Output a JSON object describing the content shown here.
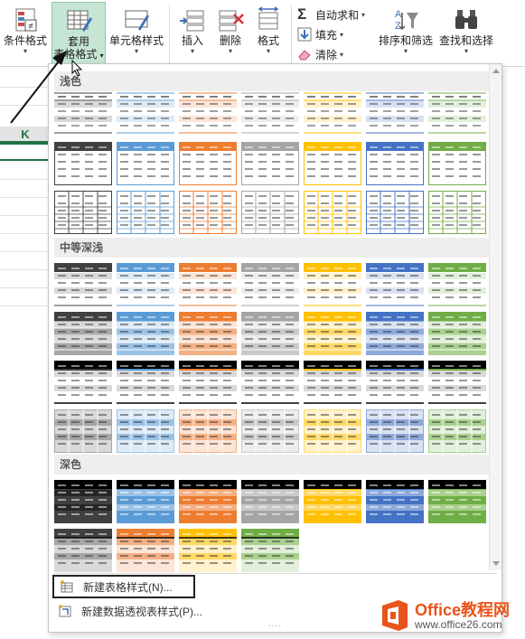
{
  "ribbon": {
    "buttons": [
      {
        "label": "条件格式",
        "icon": "conditional-format-icon"
      },
      {
        "label_top": "套用",
        "label_bottom": "表格格式",
        "icon": "table-format-icon",
        "active": true
      },
      {
        "label": "单元格样式",
        "icon": "cell-styles-icon"
      },
      {
        "label": "插入",
        "icon": "insert-cells-icon"
      },
      {
        "label": "删除",
        "icon": "delete-cells-icon"
      },
      {
        "label": "格式",
        "icon": "format-cells-icon"
      },
      {
        "label": "排序和筛选",
        "icon": "sort-filter-icon"
      },
      {
        "label": "查找和选择",
        "icon": "find-select-icon"
      }
    ],
    "editing": {
      "autosum": "自动求和",
      "fill": "填充",
      "clear": "清除"
    }
  },
  "sheet": {
    "column_header": "K"
  },
  "gallery": {
    "sections": [
      {
        "title": "浅色"
      },
      {
        "title": "中等深浅"
      },
      {
        "title": "深色"
      }
    ],
    "colors": {
      "black": "#404040",
      "blue": "#5b9bd5",
      "orange": "#ed7d31",
      "gray": "#a5a5a5",
      "gold": "#ffc000",
      "darkblue": "#4472c4",
      "green": "#70ad47"
    },
    "light_style_counts": [
      7,
      7,
      7
    ],
    "medium_style_counts": [
      7,
      7,
      7,
      7
    ],
    "dark_style_counts": [
      7,
      4
    ],
    "menu": {
      "new_table_style": "新建表格样式(N)...",
      "new_pivot_style": "新建数据透视表样式(P)..."
    }
  },
  "watermark": {
    "title": "Office教程网",
    "url": "www.office26.com"
  }
}
